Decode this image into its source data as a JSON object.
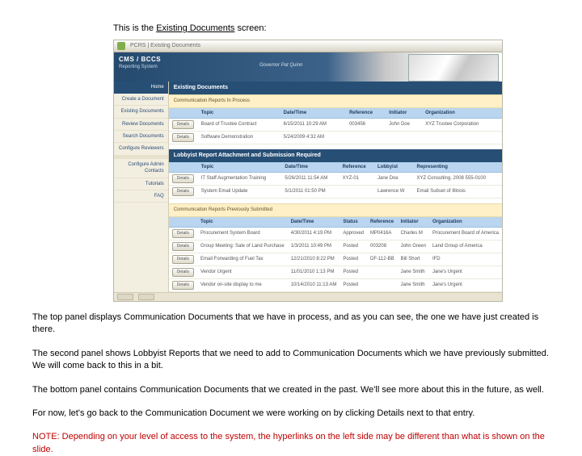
{
  "intro_pre": "This is the ",
  "intro_link": "Existing Documents",
  "intro_post": " screen:",
  "win": {
    "crumb": "PCRS | Existing Documents",
    "brand": "CMS / BCCS",
    "brand_sub": "Reporting System",
    "gov": "Governor Pat Quinn"
  },
  "side": {
    "home": "Home",
    "items": [
      "Create a Document",
      "Existing Documents",
      "Review Documents",
      "Search Documents",
      "Configure Reviewers"
    ],
    "items2": [
      "Configure Admin Contacts",
      "Tutorials",
      "FAQ"
    ]
  },
  "sec1": {
    "title": "Existing Documents",
    "sub": "Communication Reports In Process",
    "cols": [
      "",
      "Topic",
      "Date/Time",
      "Reference",
      "Initiator",
      "Organization"
    ],
    "rows": [
      {
        "btn": "Details",
        "c": [
          "Board of Trustee Contract",
          "6/15/2011 10:29 AM",
          "003456",
          "John Doe",
          "XYZ Trustee Corporation"
        ]
      },
      {
        "btn": "Details",
        "c": [
          "Software Demonstration",
          "5/24/2009 4:32 AM",
          "",
          "",
          ""
        ]
      }
    ]
  },
  "sec2": {
    "title": "Lobbyist Report Attachment and Submission Required",
    "cols": [
      "",
      "Topic",
      "Date/Time",
      "Reference",
      "Lobbyist",
      "Representing"
    ],
    "rows": [
      {
        "btn": "Details",
        "c": [
          "IT Staff Augmentation Training",
          "5/26/2011 11:54 AM",
          "XYZ-01",
          "Jane Doe",
          "XYZ Consulting, 2008 555-0100"
        ]
      },
      {
        "btn": "Details",
        "c": [
          "System Email Update",
          "5/1/2011 01:50 PM",
          "",
          "Lawrence W",
          "Email Subset of Illinois"
        ]
      }
    ]
  },
  "sec3": {
    "sub": "Communication Reports Previously Submitted",
    "cols": [
      "",
      "Topic",
      "Date/Time",
      "Status",
      "Reference",
      "Initiator",
      "Organization"
    ],
    "rows": [
      {
        "btn": "Details",
        "c": [
          "Procurement System Board",
          "4/30/2011 4:19 PM",
          "Approved",
          "MP0416A",
          "Charles M",
          "Procurement Board of America"
        ]
      },
      {
        "btn": "Details",
        "c": [
          "Group Meeting: Sale of Land Purchase",
          "1/3/2011 10:49 PM",
          "Posted",
          "003208",
          "John Green",
          "Land Group of America"
        ]
      },
      {
        "btn": "Details",
        "c": [
          "Email Forwarding of Fuel Tax",
          "12/21/2010 8:22 PM",
          "Posted",
          "DF-112-BB",
          "Bill Short",
          "IFD"
        ]
      },
      {
        "btn": "Details",
        "c": [
          "Vendor Urgent",
          "11/01/2010 1:13 PM",
          "Posted",
          "",
          "Jane Smith",
          "Jane's Urgent"
        ]
      },
      {
        "btn": "Details",
        "c": [
          "Vendor on-site display to me",
          "10/14/2010 11:13 AM",
          "Posted",
          "",
          "Jane Smith",
          "Jane's Urgent"
        ]
      }
    ]
  },
  "paras": [
    "The top panel displays Communication Documents that we have in process, and as you can see, the one we have just created is there.",
    "The second panel shows Lobbyist Reports that we need to add to Communication Documents which we have previously submitted.  We will come back to this in a bit.",
    "The bottom panel contains Communication Documents that we created in the past.  We'll see more about this in the future, as well.",
    "For now, let's go back to the Communication Document we were working on by clicking Details next to that entry."
  ],
  "note": "NOTE:  Depending on your level of access to the system, the hyperlinks on the left side may be different than what is shown on the slide."
}
